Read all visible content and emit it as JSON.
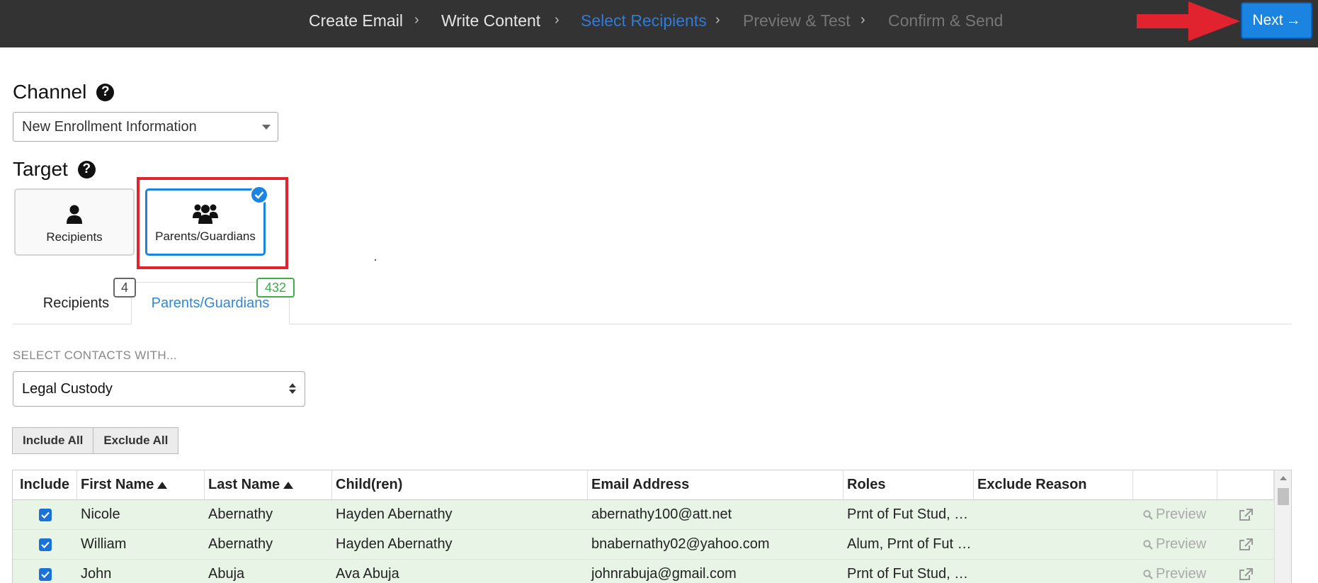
{
  "wizard": {
    "steps": [
      {
        "label": "Create Email",
        "state": "done"
      },
      {
        "label": "Write Content",
        "state": "done"
      },
      {
        "label": "Select Recipients",
        "state": "active"
      },
      {
        "label": "Preview & Test",
        "state": "todo"
      },
      {
        "label": "Confirm & Send",
        "state": "todo"
      }
    ],
    "next_label": "Next",
    "next_arrow": "→"
  },
  "channel": {
    "label": "Channel",
    "help_glyph": "?",
    "selected": "New Enrollment Information"
  },
  "target": {
    "label": "Target",
    "help_glyph": "?",
    "options": [
      {
        "label": "Recipients",
        "icon": "user-icon",
        "selected": false
      },
      {
        "label": "Parents/Guardians",
        "icon": "group-icon",
        "selected": true
      }
    ]
  },
  "tabs": [
    {
      "label": "Recipients",
      "count": "4",
      "active": false
    },
    {
      "label": "Parents/Guardians",
      "count": "432",
      "active": true
    }
  ],
  "contacts_filter": {
    "label": "SELECT CONTACTS WITH...",
    "selected": "Legal Custody"
  },
  "bulk_actions": {
    "include_all": "Include All",
    "exclude_all": "Exclude All"
  },
  "table": {
    "columns": [
      "Include",
      "First Name",
      "Last Name",
      "Child(ren)",
      "Email Address",
      "Roles",
      "Exclude Reason",
      "",
      ""
    ],
    "preview_label": "Preview",
    "rows": [
      {
        "included": true,
        "first": "Nicole",
        "last": "Abernathy",
        "children": "Hayden Abernathy",
        "email": "abernathy100@att.net",
        "roles": "Prnt of Fut Stud, …",
        "exclude_reason": ""
      },
      {
        "included": true,
        "first": "William",
        "last": "Abernathy",
        "children": "Hayden Abernathy",
        "email": "bnabernathy02@yahoo.com",
        "roles": "Alum, Prnt of Fut …",
        "exclude_reason": ""
      },
      {
        "included": true,
        "first": "John",
        "last": "Abuja",
        "children": "Ava Abuja",
        "email": "johnrabuja@gmail.com",
        "roles": "Prnt of Fut Stud, …",
        "exclude_reason": ""
      }
    ]
  },
  "colors": {
    "topbar": "#333333",
    "active_step": "#2f7bd6",
    "accent": "#1a84e0",
    "annotation_red": "#e0232e",
    "included_row": "#e8f5e6",
    "badge_green": "#3fae49"
  }
}
